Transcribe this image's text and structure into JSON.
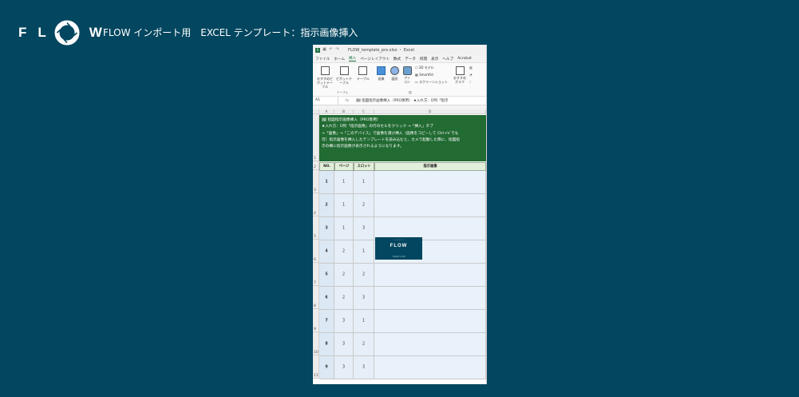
{
  "brand": {
    "letters": [
      "F",
      "L",
      "W"
    ]
  },
  "page_title": "FLOW インポート用　EXCEL テンプレート：指示画像挿入",
  "excel": {
    "file_name": "FLOW_template_pro.xlsx ・ Excel",
    "menu": [
      "ファイル",
      "ホーム",
      "挿入",
      "ページレイアウト",
      "数式",
      "データ",
      "校閲",
      "表示",
      "ヘルプ",
      "Acrobat"
    ],
    "active_menu": "挿入",
    "ribbon": {
      "pivot_recommended": "おすすめピボットテーブル",
      "pivot": "ピボットテーブル",
      "table": "テーブル",
      "image": "画像",
      "shape": "図形",
      "icon": "アイコン",
      "model3d": "3D モデル",
      "smartart": "SmartArt",
      "screenshot": "スクリーンショット",
      "recommended_graph": "おすすめグラフ",
      "group_table": "テーブル",
      "group_illust": "図"
    },
    "namebox": "A1",
    "fx": "fx",
    "formula": "🖼 指図指示画像挿入（PRO専用） ★入れ方：D列「指示",
    "columns": [
      "A",
      "B",
      "C",
      "D"
    ],
    "banner": [
      "🖼 指図指示画像挿入（PRO専用）",
      "★入れ方：D列「指示画像」の行のセルをクリック →「挿入」タブ",
      "→「画像」→「このデバイス」で画像を選び挿入（画像をコピーして Ctrl+V でも",
      "可）指示画像を挿入したテンプレートを読み込むと、カメラ起動した際に、指図指",
      "示の横に指示画像が表示されるようになります。"
    ],
    "headers": [
      "NO.",
      "ページ",
      "スロット",
      "指示画像"
    ],
    "rows": [
      {
        "no": "1",
        "page": "1",
        "slot": "1"
      },
      {
        "no": "2",
        "page": "1",
        "slot": "2"
      },
      {
        "no": "3",
        "page": "1",
        "slot": "3"
      },
      {
        "no": "4",
        "page": "2",
        "slot": "1"
      },
      {
        "no": "5",
        "page": "2",
        "slot": "2"
      },
      {
        "no": "6",
        "page": "2",
        "slot": "3"
      },
      {
        "no": "7",
        "page": "3",
        "slot": "1"
      },
      {
        "no": "8",
        "page": "3",
        "slot": "2"
      },
      {
        "no": "9",
        "page": "3",
        "slot": "3"
      }
    ],
    "row_numbers": [
      "1",
      "2",
      "3",
      "4",
      "5",
      "6",
      "7",
      "8",
      "9",
      "10",
      "11"
    ],
    "thumbnail": {
      "text": "FLOW",
      "tag": "TIGER LIVE"
    }
  },
  "colors": {
    "background": "#03465f",
    "banner": "#226b33",
    "header_fill": "#e2efda"
  }
}
